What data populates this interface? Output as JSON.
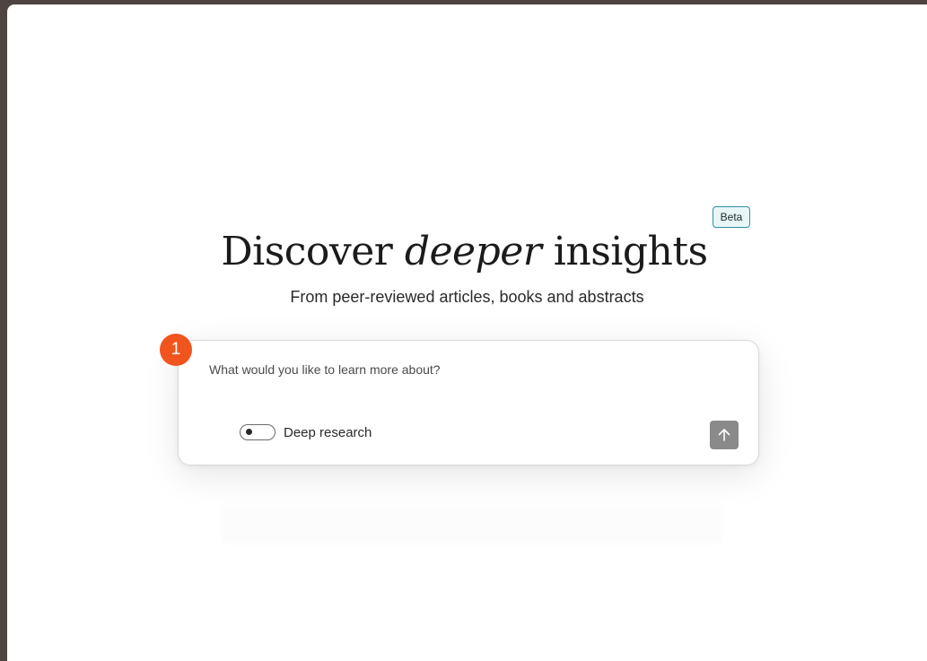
{
  "hero": {
    "title_before": "Discover ",
    "title_emphasis": "deeper",
    "title_after": " insights",
    "beta_badge": "Beta",
    "subtitle": "From peer-reviewed articles, books and abstracts"
  },
  "search": {
    "placeholder": "What would you like to learn more about?",
    "value": "",
    "deep_research_label": "Deep research",
    "deep_research_enabled": false,
    "submit_icon": "arrow-up-icon"
  },
  "annotation": {
    "step_number": "1",
    "color": "#f2541e"
  },
  "colors": {
    "frame": "#4e4441",
    "beta_border": "#2f8fa3",
    "submit_button": "#8a8a8a"
  }
}
